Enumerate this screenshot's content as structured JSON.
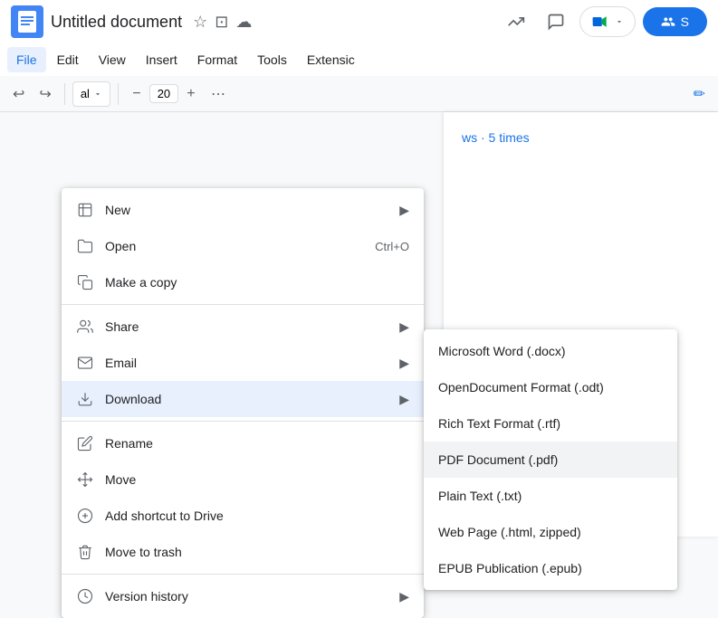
{
  "titleBar": {
    "appIcon": "≡",
    "docTitle": "Untitled document",
    "starIcon": "★",
    "driveIcon": "☁",
    "saveIcon": "⊡"
  },
  "menuBar": {
    "items": [
      {
        "label": "File",
        "active": true
      },
      {
        "label": "Edit",
        "active": false
      },
      {
        "label": "View",
        "active": false
      },
      {
        "label": "Insert",
        "active": false
      },
      {
        "label": "Format",
        "active": false
      },
      {
        "label": "Tools",
        "active": false
      },
      {
        "label": "Extensic",
        "active": false
      }
    ]
  },
  "toolbar": {
    "undoLabel": "↩",
    "redoLabel": "↪",
    "fontName": "al",
    "fontSize": "20",
    "moreIcon": "⋯",
    "editIcon": "✏"
  },
  "docContent": {
    "blueText": "ws  · 5 times"
  },
  "fileMenu": {
    "items": [
      {
        "id": "new",
        "icon": "▦",
        "label": "New",
        "shortcut": "",
        "arrow": "▶",
        "hasDividerAfter": false
      },
      {
        "id": "open",
        "icon": "📂",
        "label": "Open",
        "shortcut": "Ctrl+O",
        "arrow": "",
        "hasDividerAfter": false
      },
      {
        "id": "make-copy",
        "icon": "⧉",
        "label": "Make a copy",
        "shortcut": "",
        "arrow": "",
        "hasDividerAfter": true
      },
      {
        "id": "share",
        "icon": "👤",
        "label": "Share",
        "shortcut": "",
        "arrow": "▶",
        "hasDividerAfter": false
      },
      {
        "id": "email",
        "icon": "✉",
        "label": "Email",
        "shortcut": "",
        "arrow": "▶",
        "hasDividerAfter": false
      },
      {
        "id": "download",
        "icon": "⬇",
        "label": "Download",
        "shortcut": "",
        "arrow": "▶",
        "active": true,
        "hasDividerAfter": true
      },
      {
        "id": "rename",
        "icon": "✎",
        "label": "Rename",
        "shortcut": "",
        "arrow": "",
        "hasDividerAfter": false
      },
      {
        "id": "move",
        "icon": "⤴",
        "label": "Move",
        "shortcut": "",
        "arrow": "",
        "hasDividerAfter": false
      },
      {
        "id": "add-shortcut",
        "icon": "⊕",
        "label": "Add shortcut to Drive",
        "shortcut": "",
        "arrow": "",
        "hasDividerAfter": false
      },
      {
        "id": "trash",
        "icon": "🗑",
        "label": "Move to trash",
        "shortcut": "",
        "arrow": "",
        "hasDividerAfter": true
      },
      {
        "id": "version-history",
        "icon": "🕐",
        "label": "Version history",
        "shortcut": "",
        "arrow": "▶",
        "hasDividerAfter": false
      }
    ]
  },
  "downloadSubmenu": {
    "items": [
      {
        "id": "docx",
        "label": "Microsoft Word (.docx)"
      },
      {
        "id": "odt",
        "label": "OpenDocument Format (.odt)"
      },
      {
        "id": "rtf",
        "label": "Rich Text Format (.rtf)"
      },
      {
        "id": "pdf",
        "label": "PDF Document (.pdf)",
        "highlighted": true
      },
      {
        "id": "txt",
        "label": "Plain Text (.txt)"
      },
      {
        "id": "html",
        "label": "Web Page (.html, zipped)"
      },
      {
        "id": "epub",
        "label": "EPUB Publication (.epub)"
      }
    ]
  }
}
